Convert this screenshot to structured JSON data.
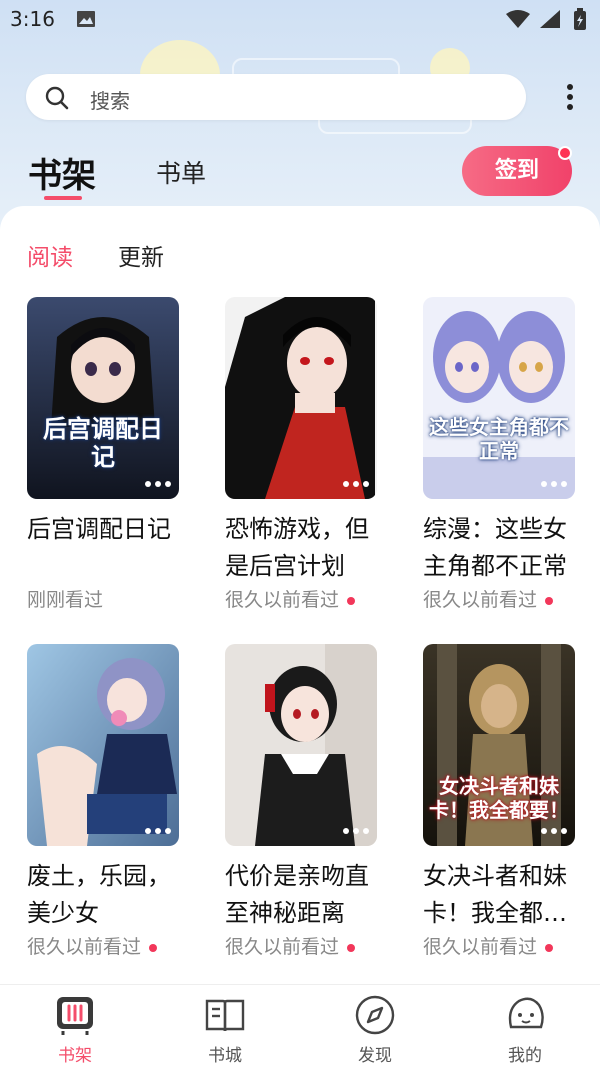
{
  "status_bar": {
    "time": "3:16"
  },
  "search": {
    "placeholder": "搜索"
  },
  "top_tabs": {
    "bookshelf": "书架",
    "booklist": "书单"
  },
  "signin_button": "签到",
  "sub_tabs": {
    "reading": "阅读",
    "updates": "更新"
  },
  "books": [
    {
      "title": "后宫调配日记",
      "status": "刚刚看过",
      "cover_text": "后宫调配日记",
      "new_update": false
    },
    {
      "title": "恐怖游戏，但是后宫计划",
      "status": "很久以前看过",
      "new_update": true
    },
    {
      "title": "综漫：这些女主角都不正常",
      "status": "很久以前看过",
      "cover_text": "这些女主角都不正常",
      "new_update": true
    },
    {
      "title": "废土，乐园，美少女",
      "status": "很久以前看过",
      "new_update": true
    },
    {
      "title": "代价是亲吻直至神秘距离",
      "status": "很久以前看过",
      "new_update": true
    },
    {
      "title": "女决斗者和妹卡！我全都…",
      "status": "很久以前看过",
      "cover_text": "女决斗者和妹卡！我全都要！",
      "new_update": true
    }
  ],
  "bottom_nav": [
    {
      "label": "书架",
      "icon": "bookshelf-icon",
      "active": true
    },
    {
      "label": "书城",
      "icon": "bookstore-icon",
      "active": false
    },
    {
      "label": "发现",
      "icon": "compass-icon",
      "active": false
    },
    {
      "label": "我的",
      "icon": "profile-icon",
      "active": false
    }
  ],
  "colors": {
    "accent": "#f44d6a",
    "signin_gradient_start": "#f66b85",
    "signin_gradient_end": "#f1426a"
  }
}
